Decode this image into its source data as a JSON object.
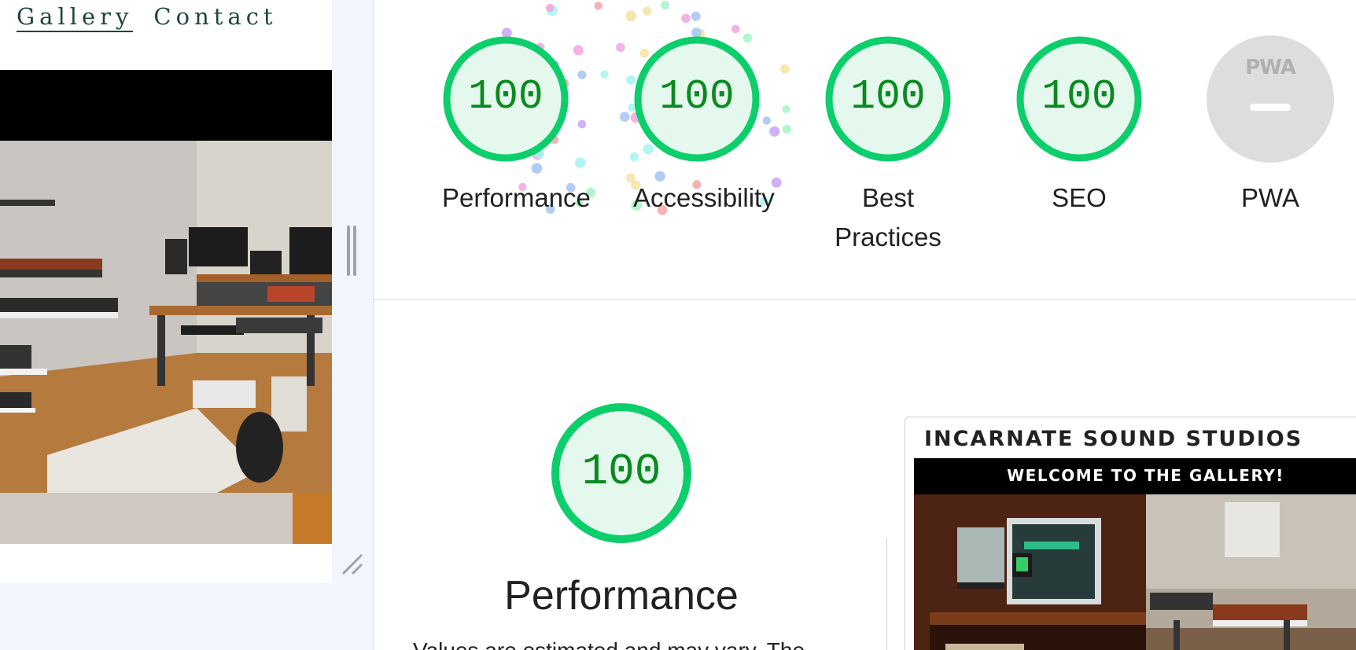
{
  "site": {
    "nav": [
      "Gallery",
      "Contact"
    ]
  },
  "categories": [
    {
      "label": "Performance",
      "score": "100"
    },
    {
      "label": "Accessibility",
      "score": "100"
    },
    {
      "label": "Best Practices",
      "score": "100"
    },
    {
      "label": "SEO",
      "score": "100"
    },
    {
      "label": "PWA",
      "score": ""
    }
  ],
  "pwa_badge": "PWA",
  "performance_section": {
    "score": "100",
    "title": "Performance",
    "description_partial": "Values are estimated and may vary. The"
  },
  "preview": {
    "site_title": "INCARNATE SOUND STUDIOS",
    "banner": "WELCOME TO THE GALLERY!"
  },
  "colors": {
    "pass_green": "#0cce6b",
    "pass_fill": "#e5f8ee",
    "score_text": "#0a8a1f",
    "pwa_gray": "#dddddd"
  }
}
